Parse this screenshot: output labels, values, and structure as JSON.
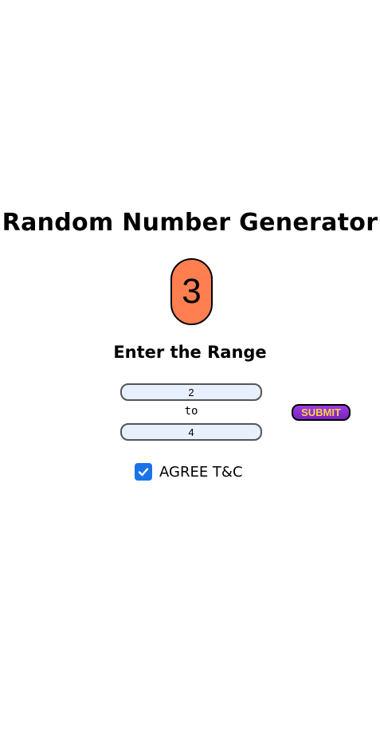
{
  "app": {
    "title": "Random Number Generator",
    "result": "3",
    "range_heading": "Enter the Range"
  },
  "range": {
    "min_value": "2",
    "separator": "to",
    "max_value": "4"
  },
  "actions": {
    "submit_label": "SUBMIT"
  },
  "agreement": {
    "checked": true,
    "label": "AGREE T&C"
  },
  "colors": {
    "result_bg": "#ff7f50",
    "input_bg": "#e8f0fe",
    "submit_bg": "#8a2be2",
    "submit_text": "#ffd23f",
    "checkbox": "#1a73e8"
  },
  "icons": {
    "checkbox_icon": "checkmark-icon"
  }
}
